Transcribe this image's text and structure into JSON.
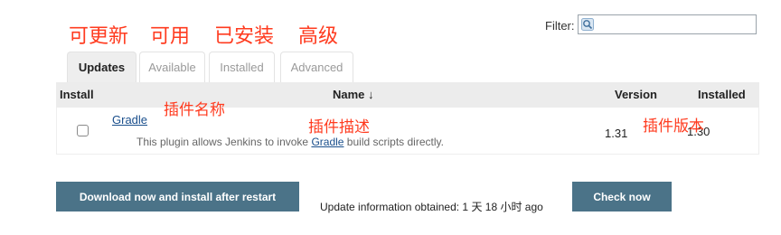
{
  "annotations": {
    "updates": "可更新",
    "available": "可用",
    "installed": "已安装",
    "advanced": "高级",
    "plugin_name": "插件名称",
    "plugin_desc": "插件描述",
    "plugin_version": "插件版本"
  },
  "filter": {
    "label": "Filter:",
    "value": "",
    "icon": "search-icon"
  },
  "tabs": [
    {
      "label": "Updates",
      "active": true
    },
    {
      "label": "Available",
      "active": false
    },
    {
      "label": "Installed",
      "active": false
    },
    {
      "label": "Advanced",
      "active": false
    }
  ],
  "table": {
    "headers": {
      "install": "Install",
      "name": "Name ↓",
      "version": "Version",
      "installed": "Installed"
    },
    "rows": [
      {
        "name": "Gradle",
        "desc_before": "This plugin allows Jenkins to invoke ",
        "desc_link": "Gradle",
        "desc_after": " build scripts directly.",
        "version": "1.31",
        "installed": "1.30",
        "checked": false
      }
    ]
  },
  "actions": {
    "download_label": "Download now and install after restart",
    "update_info": "Update information obtained: 1 天 18 小时 ago",
    "check_label": "Check now"
  },
  "colors": {
    "annotation": "#ff3b1f",
    "button": "#4b7388",
    "link": "#1a4f8c"
  }
}
